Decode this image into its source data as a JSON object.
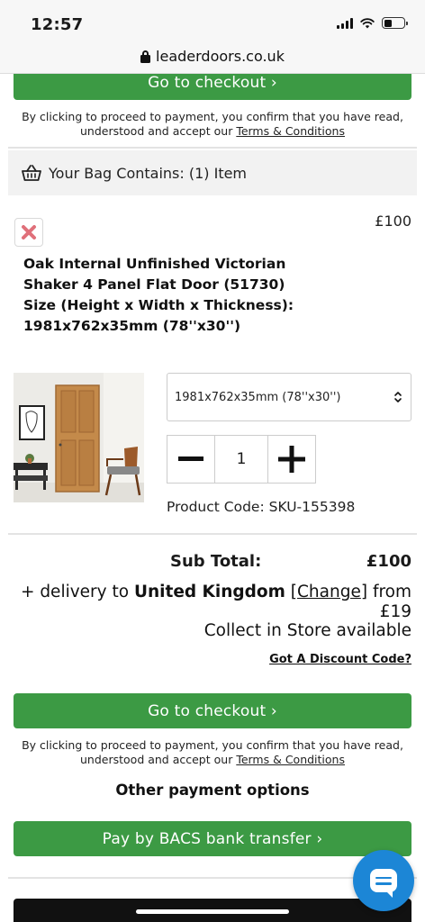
{
  "status_bar": {
    "time": "12:57"
  },
  "browser": {
    "url": "leaderdoors.co.uk"
  },
  "top_checkout": {
    "button_label": "Go to checkout ›",
    "legal_line1": "By clicking to proceed to payment, you confirm that you have read,",
    "legal_line2_prefix": "understood and accept our ",
    "terms_link": "Terms & Conditions"
  },
  "bag": {
    "header": "Your Bag Contains: (1) Item"
  },
  "item": {
    "price": "£100",
    "title": "Oak Internal Unfinished Victorian Shaker 4 Panel Flat Door (51730) Size (Height x Width x Thickness): 1981x762x35mm (78''x30'')",
    "size_selected": "1981x762x35mm (78''x30'')",
    "quantity": "1",
    "product_code": "Product Code: SKU-155398"
  },
  "summary": {
    "subtotal_label": "Sub Total:",
    "subtotal_value": "£100",
    "delivery_prefix": "+ delivery to ",
    "delivery_country": "United Kingdom",
    "delivery_change_open": " [",
    "delivery_change": "Change",
    "delivery_change_close": "]",
    "delivery_suffix": " from £19",
    "collect": "Collect in Store available",
    "discount_link": "Got A Discount Code?"
  },
  "bottom_checkout": {
    "button_label": "Go to checkout ›",
    "legal_line1": "By clicking to proceed to payment, you confirm that you have read,",
    "legal_line2_prefix": "understood and accept our ",
    "terms_link": "Terms & Conditions"
  },
  "payment": {
    "other_heading": "Other payment options",
    "bacs_label": "Pay by BACS bank transfer ›"
  },
  "colors": {
    "accent_green": "#3c9a44",
    "remove_red": "#e0707a",
    "chat_blue": "#1c86d6"
  },
  "icons": [
    "lock-icon",
    "basket-icon",
    "close-icon",
    "select-arrows-icon",
    "minus-icon",
    "plus-icon",
    "chat-icon"
  ]
}
